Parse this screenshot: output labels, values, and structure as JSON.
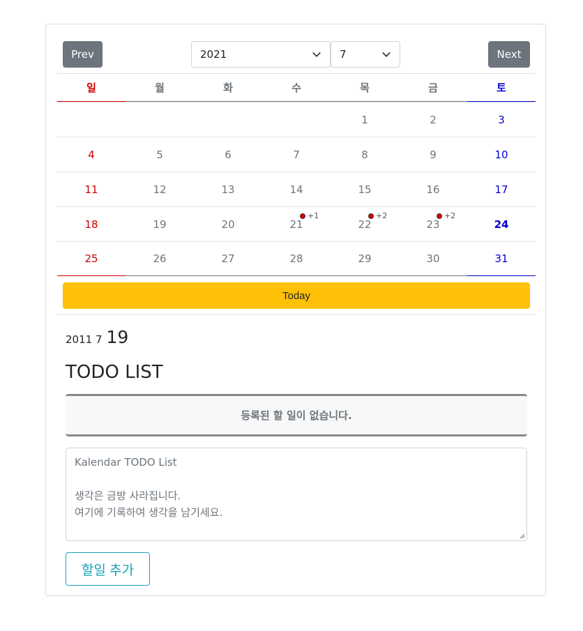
{
  "nav": {
    "prev_label": "Prev",
    "next_label": "Next",
    "year_selected": "2021",
    "month_selected": "7"
  },
  "calendar": {
    "weekdays": [
      "일",
      "월",
      "화",
      "수",
      "목",
      "금",
      "토"
    ],
    "weeks": [
      [
        {
          "d": ""
        },
        {
          "d": ""
        },
        {
          "d": ""
        },
        {
          "d": ""
        },
        {
          "d": "1"
        },
        {
          "d": "2"
        },
        {
          "d": "3"
        }
      ],
      [
        {
          "d": "4"
        },
        {
          "d": "5"
        },
        {
          "d": "6"
        },
        {
          "d": "7"
        },
        {
          "d": "8"
        },
        {
          "d": "9"
        },
        {
          "d": "10"
        }
      ],
      [
        {
          "d": "11"
        },
        {
          "d": "12"
        },
        {
          "d": "13"
        },
        {
          "d": "14"
        },
        {
          "d": "15"
        },
        {
          "d": "16"
        },
        {
          "d": "17"
        }
      ],
      [
        {
          "d": "18"
        },
        {
          "d": "19"
        },
        {
          "d": "20"
        },
        {
          "d": "21",
          "event": "+1"
        },
        {
          "d": "22",
          "event": "+2"
        },
        {
          "d": "23",
          "event": "+2"
        },
        {
          "d": "24",
          "today": true
        }
      ],
      [
        {
          "d": "25"
        },
        {
          "d": "26"
        },
        {
          "d": "27"
        },
        {
          "d": "28"
        },
        {
          "d": "29"
        },
        {
          "d": "30"
        },
        {
          "d": "31"
        }
      ]
    ]
  },
  "today_label": "Today",
  "selected_date": {
    "year_month": "2011 7",
    "day": "19"
  },
  "todo": {
    "title": "TODO LIST",
    "empty_message": "등록된 할 일이 없습니다.",
    "placeholder_lines": [
      "Kalendar TODO List",
      "",
      "생각은 금방 사라집니다.",
      "여기에 기록하여 생각을 남기세요."
    ],
    "add_label": "할일 추가"
  },
  "colors": {
    "sunday": "#cc0000",
    "saturday": "#0000cc",
    "today_button": "#ffc107",
    "nav_button": "#6c757d",
    "add_button": "#17a2b8"
  }
}
